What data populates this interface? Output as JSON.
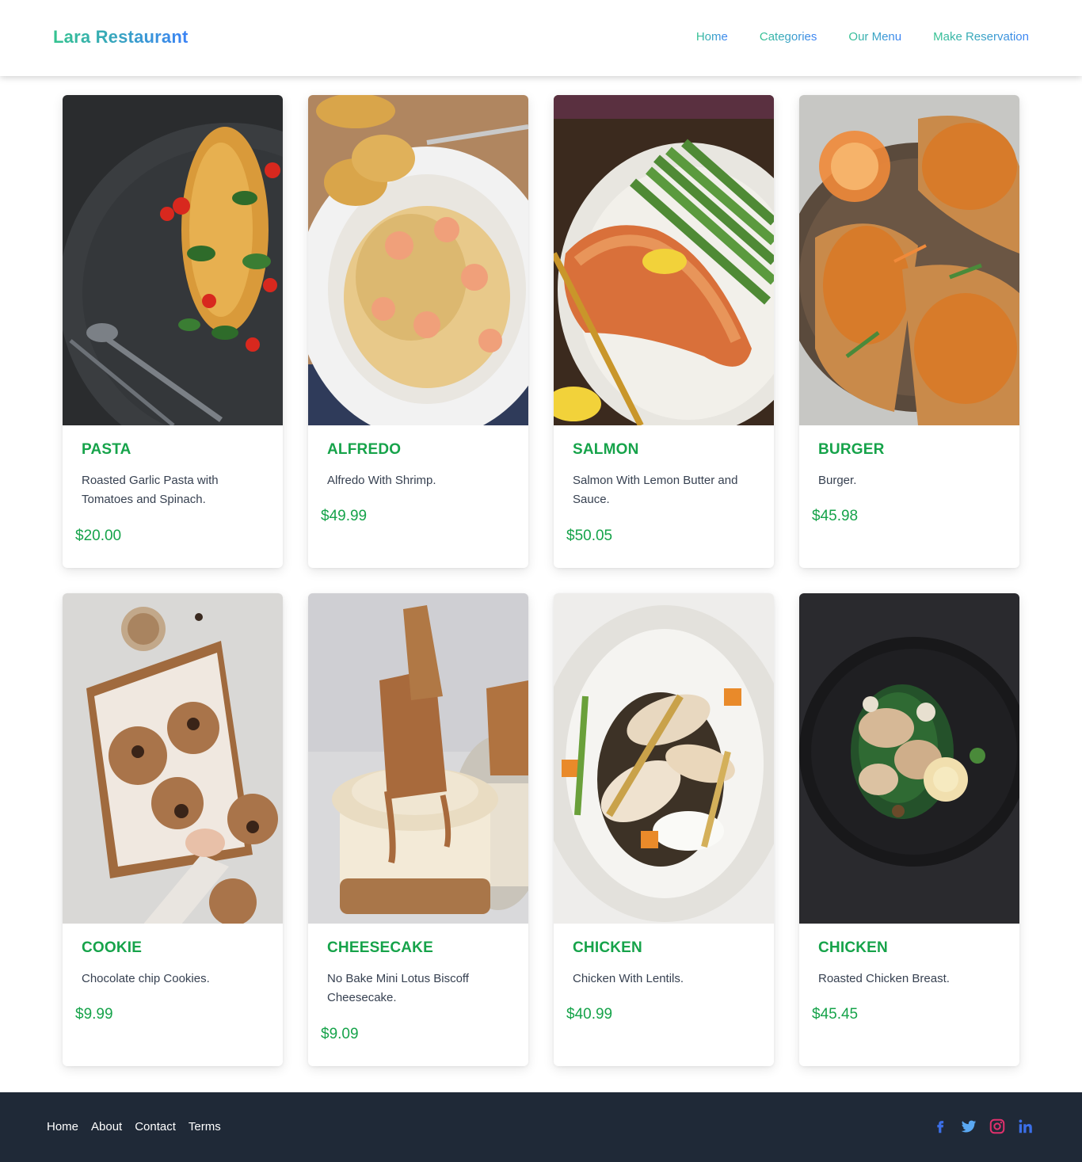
{
  "header": {
    "brand": "Lara Restaurant",
    "nav": [
      "Home",
      "Categories",
      "Our Menu",
      "Make Reservation"
    ]
  },
  "menu": [
    {
      "title": "PASTA",
      "desc": "Roasted Garlic Pasta with Tomatoes and Spinach.",
      "price": "$20.00"
    },
    {
      "title": "ALFREDO",
      "desc": "Alfredo With Shrimp.",
      "price": "$49.99"
    },
    {
      "title": "SALMON",
      "desc": "Salmon With Lemon Butter and Sauce.",
      "price": "$50.05"
    },
    {
      "title": "BURGER",
      "desc": "Burger.",
      "price": "$45.98"
    },
    {
      "title": "COOKIE",
      "desc": "Chocolate chip Cookies.",
      "price": "$9.99"
    },
    {
      "title": "CHEESECAKE",
      "desc": "No Bake Mini Lotus Biscoff Cheesecake.",
      "price": "$9.09"
    },
    {
      "title": "CHICKEN",
      "desc": "Chicken With Lentils.",
      "price": "$40.99"
    },
    {
      "title": "CHICKEN",
      "desc": "Roasted Chicken Breast.",
      "price": "$45.45"
    }
  ],
  "footer": {
    "links": [
      "Home",
      "About",
      "Contact",
      "Terms"
    ],
    "socials": [
      "facebook-icon",
      "twitter-icon",
      "instagram-icon",
      "linkedin-icon"
    ]
  },
  "colors": {
    "accent_green": "#16a34a",
    "brand_gradient_start": "#34c38f",
    "brand_gradient_end": "#3b82f6",
    "footer_bg": "#1f2937"
  }
}
